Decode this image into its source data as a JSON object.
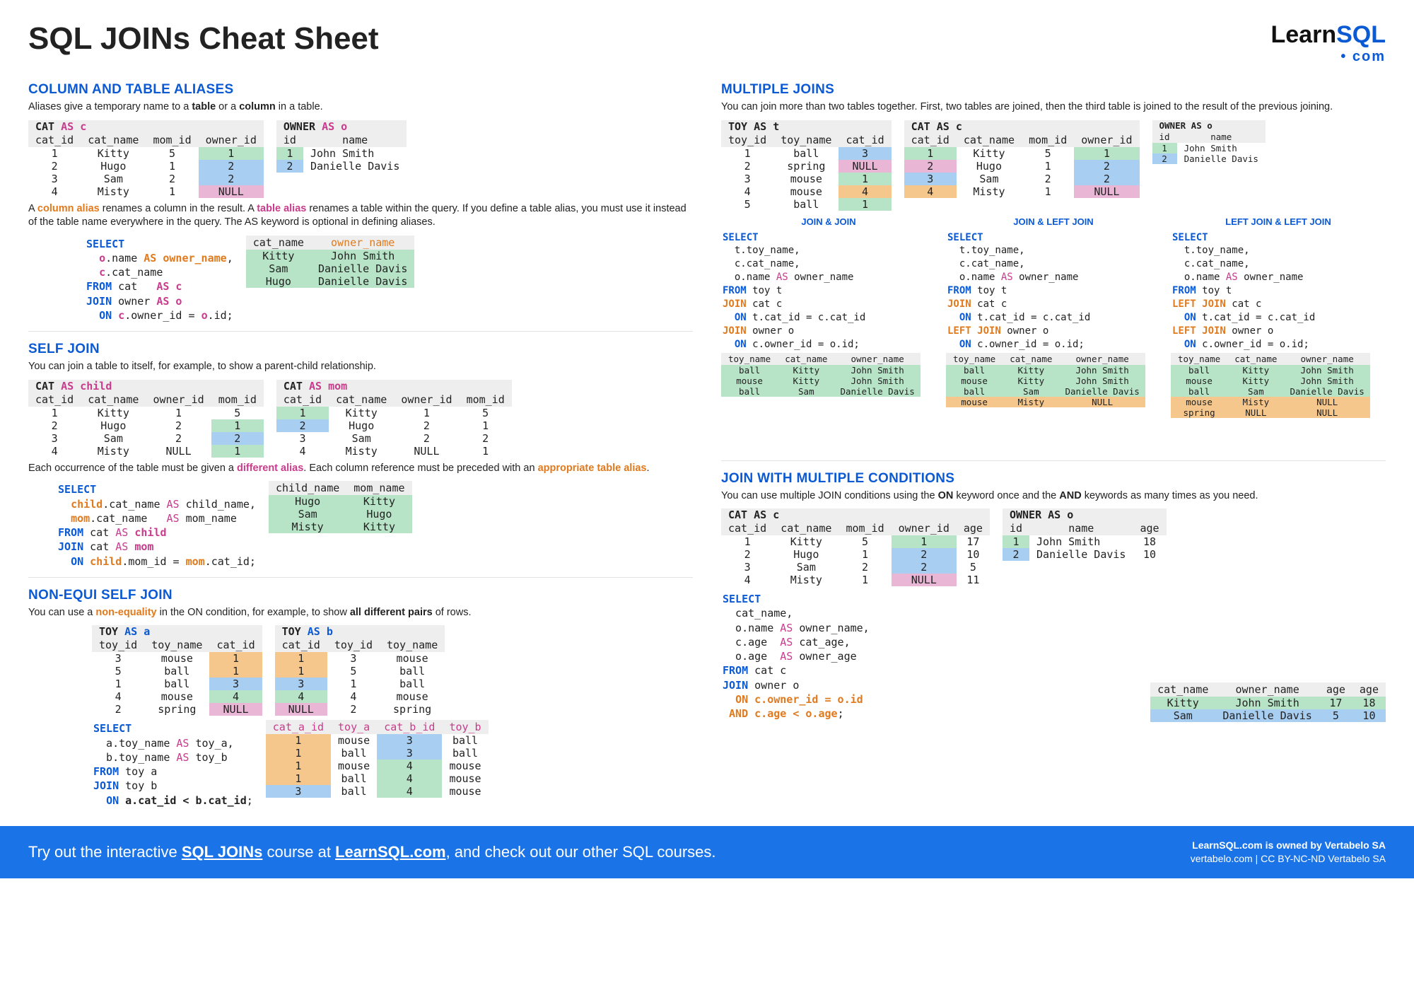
{
  "title": "SQL JOINs Cheat Sheet",
  "logo": {
    "line1a": "Learn",
    "line1b": "SQL",
    "line2": "com"
  },
  "aliases": {
    "heading": "COLUMN AND TABLE ALIASES",
    "intro_a": "Aliases give a temporary name to a ",
    "intro_b": "table",
    "intro_c": " or a ",
    "intro_d": "column",
    "intro_e": " in a table.",
    "cat_caption": "CAT",
    "cat_headers": [
      "cat_id",
      "cat_name",
      "mom_id",
      "owner_id"
    ],
    "cat_rows": [
      [
        "1",
        "Kitty",
        "5",
        "1",
        "green"
      ],
      [
        "2",
        "Hugo",
        "1",
        "2",
        "blue"
      ],
      [
        "3",
        "Sam",
        "2",
        "2",
        "blue"
      ],
      [
        "4",
        "Misty",
        "1",
        "NULL",
        "pink"
      ]
    ],
    "owner_caption": "OWNER",
    "owner_headers": [
      "id",
      "name"
    ],
    "owner_rows": [
      [
        "1",
        "John Smith",
        "green"
      ],
      [
        "2",
        "Danielle Davis",
        "blue"
      ]
    ],
    "mid_a": "A ",
    "mid_b": "column alias",
    "mid_c": " renames a column in the result. A ",
    "mid_d": "table alias",
    "mid_e": " renames a table within the query. If you define a table alias, you must use it instead of the table name everywhere in the query. The AS keyword is optional in defining aliases.",
    "res_headers": [
      "cat_name",
      "owner_name"
    ],
    "res_rows": [
      [
        "Kitty",
        "John Smith"
      ],
      [
        "Sam",
        "Danielle Davis"
      ],
      [
        "Hugo",
        "Danielle Davis"
      ]
    ]
  },
  "selfjoin": {
    "heading": "SELF JOIN",
    "intro": "You can join a table to itself, for example, to show a parent-child relationship.",
    "cat_child": "CAT",
    "cat_mom": "CAT",
    "headers": [
      "cat_id",
      "cat_name",
      "owner_id",
      "mom_id"
    ],
    "child_rows": [
      [
        "1",
        "Kitty",
        "1",
        "5",
        ""
      ],
      [
        "2",
        "Hugo",
        "2",
        "1",
        "green"
      ],
      [
        "3",
        "Sam",
        "2",
        "2",
        "blue"
      ],
      [
        "4",
        "Misty",
        "NULL",
        "1",
        "green"
      ]
    ],
    "mom_rows": [
      [
        "1",
        "Kitty",
        "1",
        "5",
        "green"
      ],
      [
        "2",
        "Hugo",
        "2",
        "1",
        "blue"
      ],
      [
        "3",
        "Sam",
        "2",
        "2",
        ""
      ],
      [
        "4",
        "Misty",
        "NULL",
        "1",
        ""
      ]
    ],
    "mid_a": "Each occurrence of the table must be given a ",
    "mid_b": "different alias",
    "mid_c": ". Each column reference must be preceded with an ",
    "mid_d": "appropriate table alias",
    "mid_e": ".",
    "res_headers": [
      "child_name",
      "mom_name"
    ],
    "res_rows": [
      [
        "Hugo",
        "Kitty"
      ],
      [
        "Sam",
        "Hugo"
      ],
      [
        "Misty",
        "Kitty"
      ]
    ]
  },
  "nonequi": {
    "heading": "NON-EQUI SELF JOIN",
    "intro_a": "You can use a ",
    "intro_b": "non-equality",
    "intro_c": " in the ON condition, for example, to show ",
    "intro_d": "all different pairs",
    "intro_e": " of rows.",
    "toy_a": "TOY",
    "toy_b": "TOY",
    "headers_a": [
      "toy_id",
      "toy_name",
      "cat_id"
    ],
    "rows_a": [
      [
        "3",
        "mouse",
        "1",
        "orange"
      ],
      [
        "5",
        "ball",
        "1",
        "orange"
      ],
      [
        "1",
        "ball",
        "3",
        "blue"
      ],
      [
        "4",
        "mouse",
        "4",
        "green"
      ],
      [
        "2",
        "spring",
        "NULL",
        "pink"
      ]
    ],
    "headers_b": [
      "cat_id",
      "toy_id",
      "toy_name"
    ],
    "rows_b": [
      [
        "1",
        "3",
        "mouse",
        "orange"
      ],
      [
        "1",
        "5",
        "ball",
        "orange"
      ],
      [
        "3",
        "1",
        "ball",
        "blue"
      ],
      [
        "4",
        "4",
        "mouse",
        "green"
      ],
      [
        "NULL",
        "2",
        "spring",
        "pink"
      ]
    ],
    "res_headers": [
      "cat_a_id",
      "toy_a",
      "cat_b_id",
      "toy_b"
    ],
    "res_rows": [
      [
        "1",
        "mouse",
        "3",
        "ball",
        "ob"
      ],
      [
        "1",
        "ball",
        "3",
        "ball",
        "ob"
      ],
      [
        "1",
        "mouse",
        "4",
        "mouse",
        "og"
      ],
      [
        "1",
        "ball",
        "4",
        "mouse",
        "og"
      ],
      [
        "3",
        "ball",
        "4",
        "mouse",
        "bg"
      ]
    ]
  },
  "multi": {
    "heading": "MULTIPLE JOINS",
    "intro": "You can join more than two tables together.  First, two tables are joined, then the third table is joined to the result of the previous joining.",
    "toy_caption": "TOY",
    "toy_headers": [
      "toy_id",
      "toy_name",
      "cat_id"
    ],
    "toy_rows": [
      [
        "1",
        "ball",
        "3",
        "blue"
      ],
      [
        "2",
        "spring",
        "NULL",
        "pink"
      ],
      [
        "3",
        "mouse",
        "1",
        "green"
      ],
      [
        "4",
        "mouse",
        "4",
        "orange"
      ],
      [
        "5",
        "ball",
        "1",
        "green"
      ]
    ],
    "cat_caption": "CAT AS c",
    "cat_headers": [
      "cat_id",
      "cat_name",
      "mom_id",
      "owner_id"
    ],
    "cat_rows": [
      [
        "1",
        "Kitty",
        "5",
        "1",
        "green",
        "green"
      ],
      [
        "2",
        "Hugo",
        "1",
        "2",
        "pink",
        "blue"
      ],
      [
        "3",
        "Sam",
        "2",
        "2",
        "blue",
        "blue"
      ],
      [
        "4",
        "Misty",
        "1",
        "NULL",
        "orange",
        "pink"
      ]
    ],
    "owner_caption": "OWNER",
    "owner_headers": [
      "id",
      "name"
    ],
    "owner_rows": [
      [
        "1",
        "John Smith",
        "green"
      ],
      [
        "2",
        "Danielle Davis",
        "blue"
      ]
    ],
    "sublabels": {
      "a": "JOIN & JOIN",
      "b": "JOIN & LEFT JOIN",
      "c": "LEFT JOIN & LEFT JOIN"
    },
    "code_cols": [
      "t.toy_name,",
      "c.cat_name,",
      "o.name AS owner_name"
    ],
    "res_headers": [
      "toy_name",
      "cat_name",
      "owner_name"
    ],
    "res_a": [
      [
        "ball",
        "Kitty",
        "John Smith"
      ],
      [
        "mouse",
        "Kitty",
        "John Smith"
      ],
      [
        "ball",
        "Sam",
        "Danielle Davis"
      ]
    ],
    "res_b": [
      [
        "ball",
        "Kitty",
        "John Smith"
      ],
      [
        "mouse",
        "Kitty",
        "John Smith"
      ],
      [
        "ball",
        "Sam",
        "Danielle Davis"
      ],
      [
        "mouse",
        "Misty",
        "NULL"
      ]
    ],
    "res_c": [
      [
        "ball",
        "Kitty",
        "John Smith"
      ],
      [
        "mouse",
        "Kitty",
        "John Smith"
      ],
      [
        "ball",
        "Sam",
        "Danielle Davis"
      ],
      [
        "mouse",
        "Misty",
        "NULL"
      ],
      [
        "spring",
        "NULL",
        "NULL"
      ]
    ]
  },
  "multi_cond": {
    "heading": "JOIN WITH MULTIPLE CONDITIONS",
    "intro_a": "You can use multiple JOIN conditions using the ",
    "intro_b": "ON",
    "intro_c": " keyword once and the ",
    "intro_d": "AND",
    "intro_e": " keywords as many times as you need.",
    "cat_caption": "CAT AS c",
    "cat_headers": [
      "cat_id",
      "cat_name",
      "mom_id",
      "owner_id",
      "age"
    ],
    "cat_rows": [
      [
        "1",
        "Kitty",
        "5",
        "1",
        "17",
        "green"
      ],
      [
        "2",
        "Hugo",
        "1",
        "2",
        "10",
        "blue"
      ],
      [
        "3",
        "Sam",
        "2",
        "2",
        "5",
        "blue"
      ],
      [
        "4",
        "Misty",
        "1",
        "NULL",
        "11",
        "pink"
      ]
    ],
    "owner_caption": "OWNER",
    "owner_headers": [
      "id",
      "name",
      "age"
    ],
    "owner_rows": [
      [
        "1",
        "John Smith",
        "18",
        "green"
      ],
      [
        "2",
        "Danielle Davis",
        "10",
        "blue"
      ]
    ],
    "res_headers": [
      "cat_name",
      "owner_name",
      "age",
      "age"
    ],
    "res_rows": [
      [
        "Kitty",
        "John Smith",
        "17",
        "18"
      ],
      [
        "Sam",
        "Danielle Davis",
        "5",
        "10"
      ]
    ]
  },
  "footer": {
    "left_a": "Try out the interactive ",
    "left_b": "SQL JOINs",
    "left_c": " course at ",
    "left_d": "LearnSQL.com",
    "left_e": ", and check out our other SQL courses.",
    "right_a": "LearnSQL.com is owned by Vertabelo SA",
    "right_b": "vertabelo.com | CC BY-NC-ND Vertabelo SA"
  }
}
